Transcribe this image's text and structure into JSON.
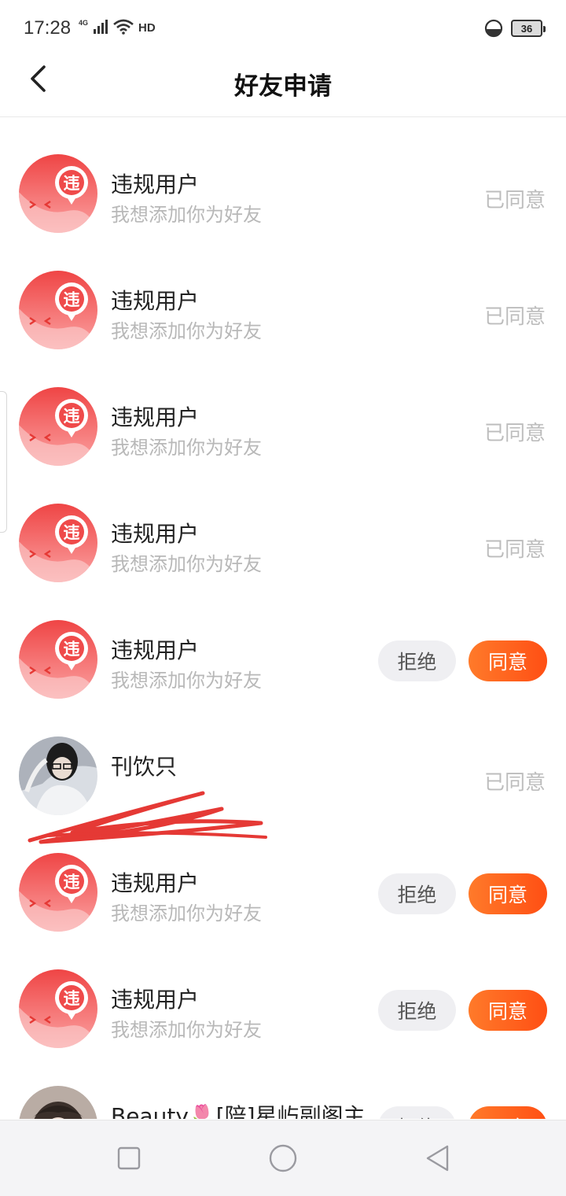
{
  "status_bar": {
    "time": "17:28",
    "network": "4G",
    "hd": "HD",
    "battery": "36"
  },
  "header": {
    "title": "好友申请"
  },
  "colors": {
    "accent": "#ff5a1f",
    "violation_avatar": "#f04747"
  },
  "requests": [
    {
      "name": "违规用户",
      "message": "我想添加你为好友",
      "state": "agreed",
      "status_label": "已同意",
      "avatar_badge": "违"
    },
    {
      "name": "违规用户",
      "message": "我想添加你为好友",
      "state": "agreed",
      "status_label": "已同意",
      "avatar_badge": "违"
    },
    {
      "name": "违规用户",
      "message": "我想添加你为好友",
      "state": "agreed",
      "status_label": "已同意",
      "avatar_badge": "违"
    },
    {
      "name": "违规用户",
      "message": "我想添加你为好友",
      "state": "agreed",
      "status_label": "已同意",
      "avatar_badge": "违"
    },
    {
      "name": "违规用户",
      "message": "我想添加你为好友",
      "state": "pending",
      "reject_label": "拒绝",
      "accept_label": "同意",
      "avatar_badge": "违"
    },
    {
      "name": "刊饮只",
      "message": "",
      "state": "agreed",
      "status_label": "已同意",
      "avatar_type": "photo",
      "redacted": true
    },
    {
      "name": "违规用户",
      "message": "我想添加你为好友",
      "state": "pending",
      "reject_label": "拒绝",
      "accept_label": "同意",
      "avatar_badge": "违"
    },
    {
      "name": "违规用户",
      "message": "我想添加你为好友",
      "state": "pending",
      "reject_label": "拒绝",
      "accept_label": "同意",
      "avatar_badge": "违"
    },
    {
      "name": "Beauty🌷[陪]星屿副阁主",
      "message": "",
      "state": "pending",
      "reject_label": "拒绝",
      "accept_label": "同意",
      "avatar_type": "photo"
    }
  ],
  "bottom_nav": {
    "buttons": [
      "recent-apps",
      "home",
      "back"
    ]
  }
}
